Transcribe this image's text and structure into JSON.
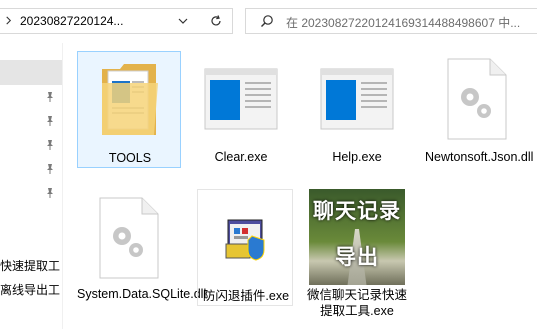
{
  "address": {
    "path": "20230827220124..."
  },
  "search": {
    "placeholder": "在 20230827220124169314488498607 中..."
  },
  "nav": {
    "items": [
      {
        "label": "快速提取工"
      },
      {
        "label": "离线导出工"
      }
    ]
  },
  "files": [
    {
      "name": "TOOLS",
      "icon": "folder-icon"
    },
    {
      "name": "Clear.exe",
      "icon": "app-window-icon"
    },
    {
      "name": "Help.exe",
      "icon": "app-window-icon"
    },
    {
      "name": "Newtonsoft.Json.dll",
      "icon": "dll-file-icon"
    },
    {
      "name": "System.Data.SQLite.dll",
      "icon": "dll-file-icon"
    },
    {
      "name": "防闪退插件.exe",
      "icon": "installer-icon"
    },
    {
      "name": "微信聊天记录快速提取工具.exe",
      "icon": "wechat-tool-icon"
    }
  ],
  "wechat_thumb": {
    "line1": "聊天记录",
    "line2": "导出"
  },
  "colors": {
    "selected_bg": "#eaf5ff",
    "selected_border": "#99d1ff",
    "app_blue": "#0078d7"
  }
}
